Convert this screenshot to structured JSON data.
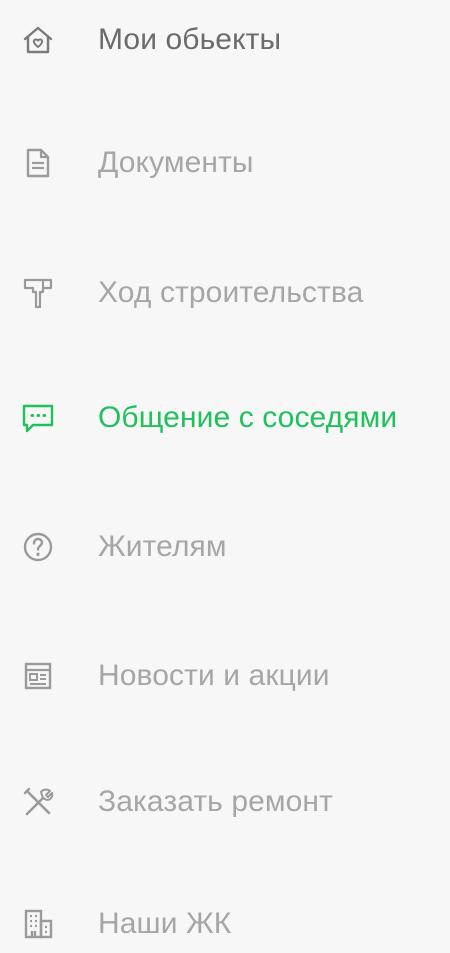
{
  "menu": {
    "items": [
      {
        "label": "Мои обьекты",
        "icon": "home-heart-icon"
      },
      {
        "label": "Документы",
        "icon": "document-icon"
      },
      {
        "label": "Ход строительства",
        "icon": "hammer-icon"
      },
      {
        "label": "Общение с соседями",
        "icon": "chat-icon",
        "active": true
      },
      {
        "label": "Жителям",
        "icon": "question-circle-icon"
      },
      {
        "label": "Новости и акции",
        "icon": "news-icon"
      },
      {
        "label": "Заказать ремонт",
        "icon": "tools-icon"
      },
      {
        "label": "Наши ЖК",
        "icon": "building-icon"
      }
    ]
  },
  "colors": {
    "background": "#f7f7f7",
    "text_primary": "#6b6b6b",
    "text_muted": "#a6a6a6",
    "accent_active": "#20c05c"
  }
}
